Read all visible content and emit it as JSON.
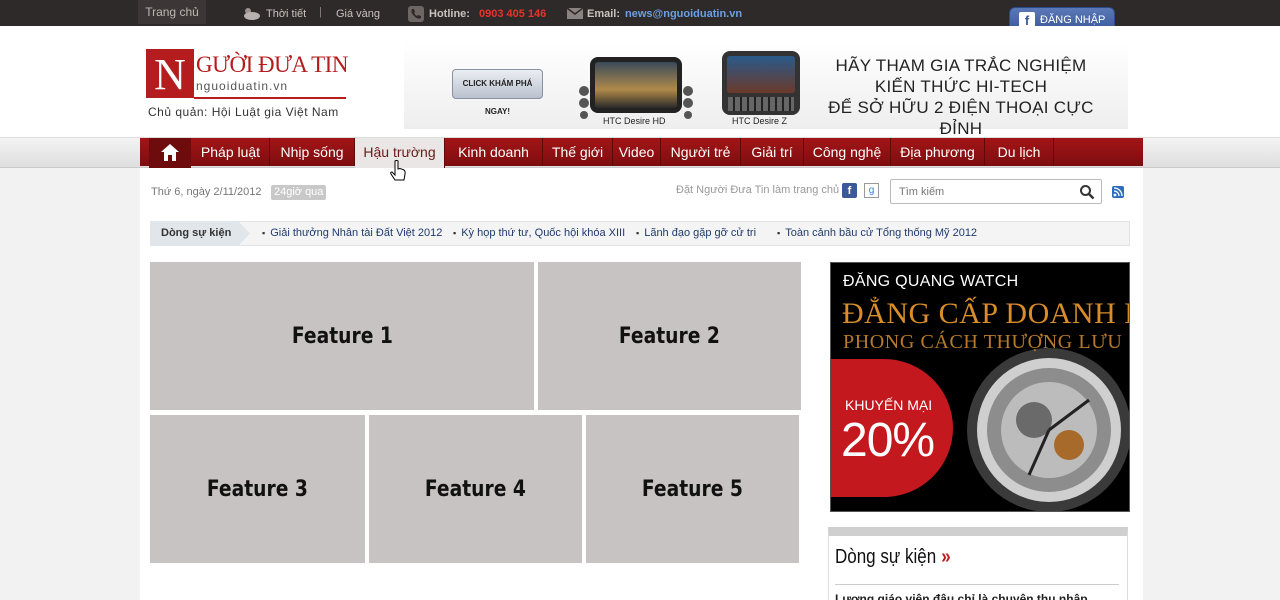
{
  "topbar": {
    "home": "Trang chủ",
    "weather": "Thời tiết",
    "separator": "|",
    "gold": "Giá vàng",
    "hotline_label": "Hotline:",
    "hotline": "0903 405 146",
    "email_label": "Email:",
    "email": "news@nguoiduatin.vn",
    "fb_login": "ĐĂNG NHẬP",
    "colors": {
      "hotline": "#e8332a",
      "email": "#6aa0e6",
      "fb": "#3b5998"
    }
  },
  "logo": {
    "letter": "N",
    "name": "GƯỜI ĐƯA TIN",
    "domain": "nguoiduatin.vn",
    "owner": "Chủ quản: Hội Luật gia Việt Nam"
  },
  "banner": {
    "cta": "CLICK KHÁM PHÁ NGAY!",
    "phone1": "HTC Desire HD",
    "phone2": "HTC Desire Z",
    "slogan_line1": "HÃY THAM GIA TRẮC NGHIỆM",
    "slogan_line2": "KIẾN THỨC HI-TECH",
    "slogan_line3": "ĐỂ SỞ HỮU 2 ĐIỆN THOẠI CỰC ĐỈNH"
  },
  "nav": {
    "active": "Hậu trường",
    "items": [
      "Pháp luật",
      "Nhịp sống",
      "Hậu trường",
      "Kinh doanh",
      "Thế giới",
      "Video",
      "Người trẻ",
      "Giải trí",
      "Công nghệ",
      "Địa phương",
      "Du lịch"
    ],
    "home_icon": "home-icon",
    "bg_color": "#9a1416"
  },
  "infobar": {
    "date": "Thứ 6, ngày 2/11/2012",
    "h24": "24giờ qua",
    "set_home": "Đặt Người Đưa Tin làm trang chủ",
    "fb": "f",
    "google": "g",
    "search_placeholder": "Tìm kiếm"
  },
  "events": {
    "label": "Dòng sự kiện",
    "items": [
      "Giải thưởng Nhân tài Đất Việt 2012",
      "Kỳ họp thứ tư, Quốc hội khóa XIII",
      "Lãnh đạo gặp gỡ cử tri",
      "Toàn cảnh bầu cử Tổng thống Mỹ 2012"
    ]
  },
  "features": [
    "Feature 1",
    "Feature 2",
    "Feature 3",
    "Feature 4",
    "Feature 5"
  ],
  "ad": {
    "brand": "ĐĂNG QUANG WATCH",
    "line1": "ĐẲNG CẤP DOANH NHÂN",
    "line2": "PHONG CÁCH THƯỢNG LƯU",
    "promo": "KHUYẾN MẠI",
    "percent": "20%"
  },
  "sidebox": {
    "title": "Dòng sự kiện",
    "chevron": "»",
    "first_item": "Lương giáo viên đâu chỉ là chuyện thu nhập"
  }
}
